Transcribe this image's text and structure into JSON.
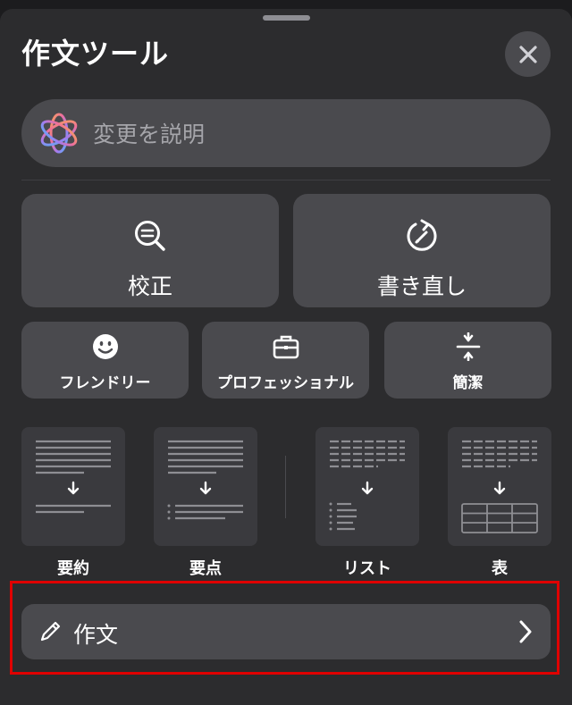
{
  "sheet": {
    "title": "作文ツール",
    "close_icon": "xmark-icon"
  },
  "prompt": {
    "placeholder": "変更を説明",
    "icon": "apple-intelligence-icon"
  },
  "actions": {
    "proofread_label": "校正",
    "rewrite_label": "書き直し"
  },
  "tones": {
    "friendly_label": "フレンドリー",
    "professional_label": "プロフェッショナル",
    "concise_label": "簡潔"
  },
  "transforms": {
    "summary_label": "要約",
    "keypoints_label": "要点",
    "list_label": "リスト",
    "table_label": "表"
  },
  "compose": {
    "label": "作文"
  },
  "colors": {
    "sheet_bg": "#2c2c2e",
    "button_bg": "#4a4a4e",
    "highlight": "#e00000"
  }
}
